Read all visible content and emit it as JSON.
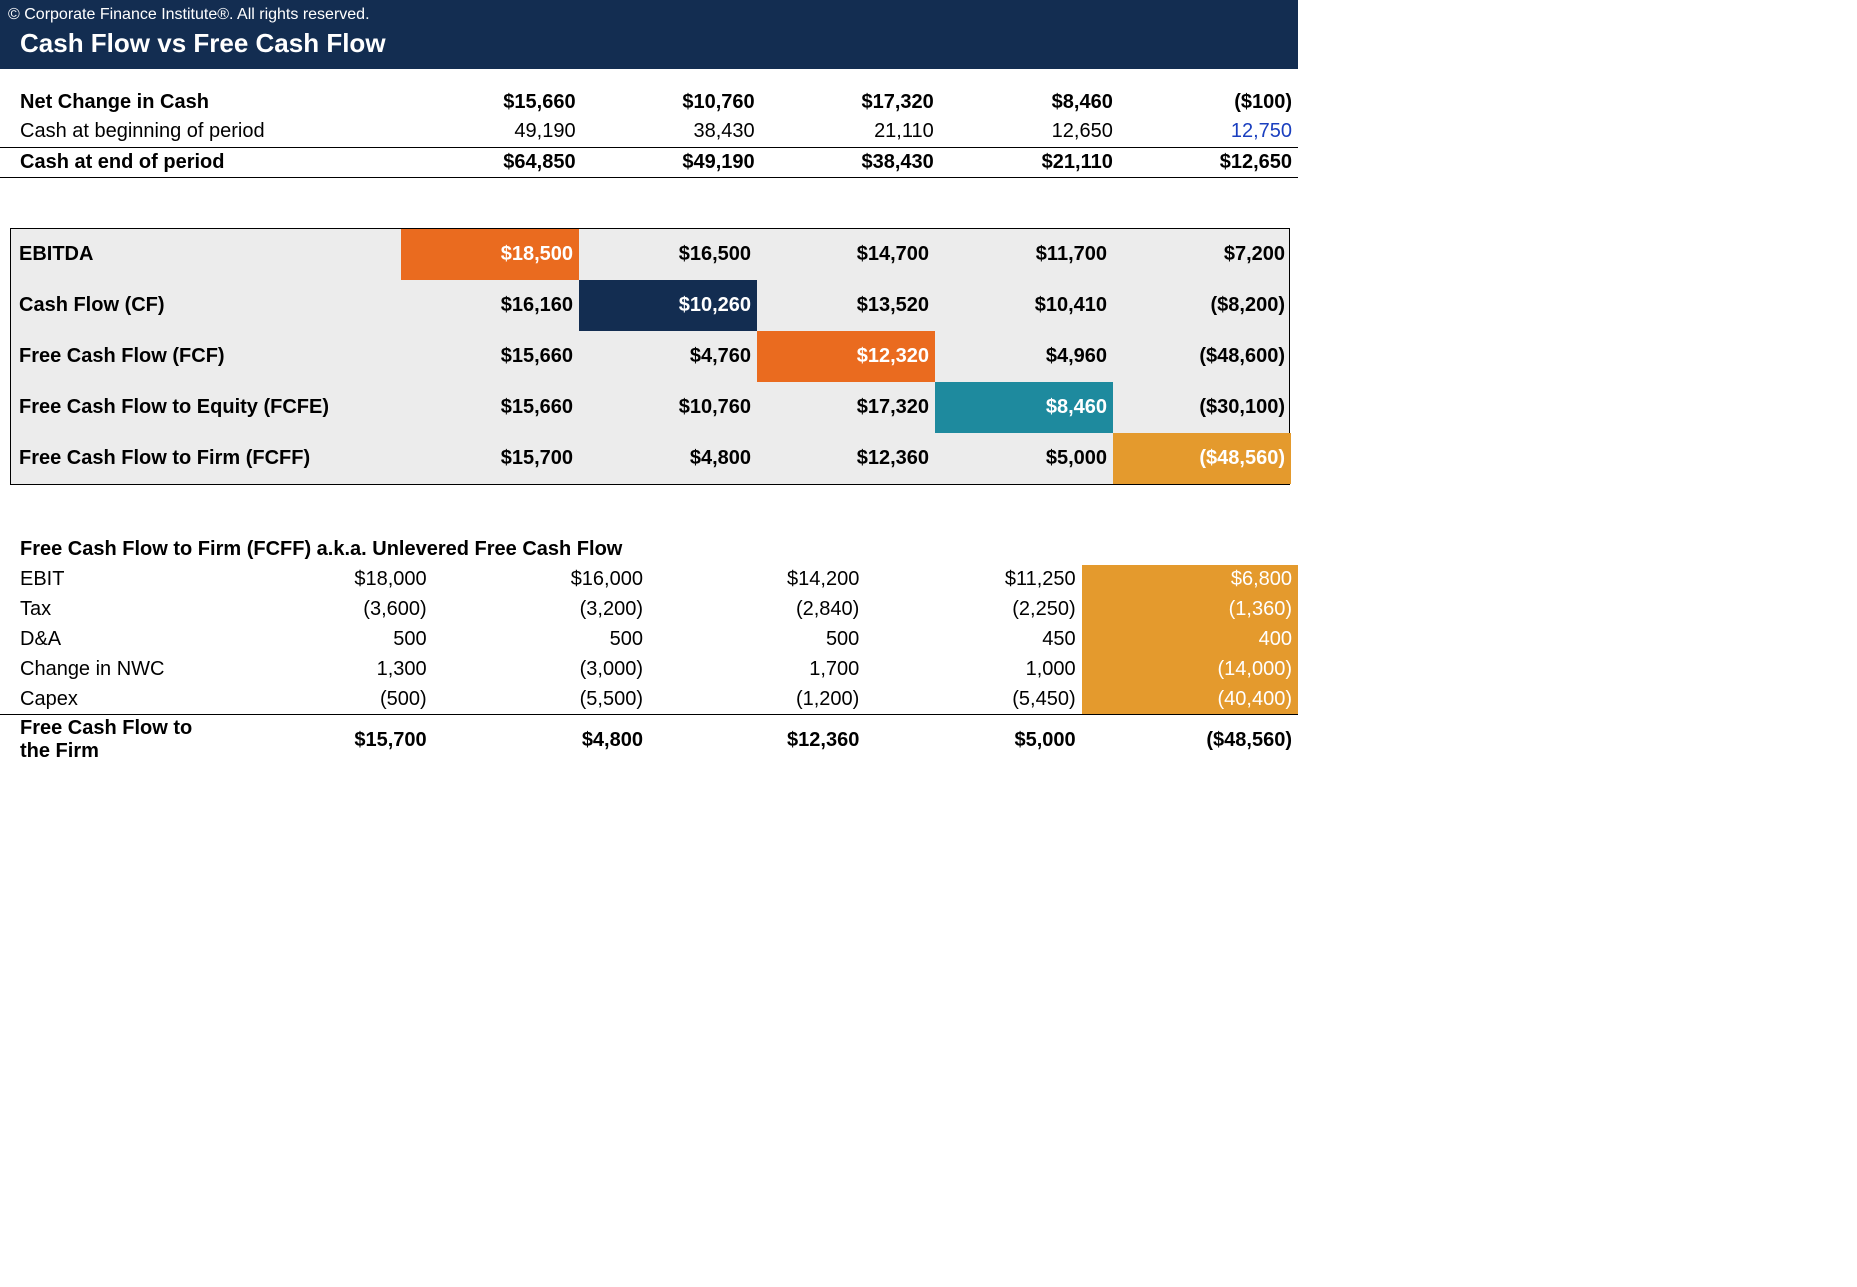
{
  "header": {
    "copyright": "© Corporate Finance Institute®. All rights reserved.",
    "title": "Cash Flow vs Free Cash Flow"
  },
  "cash_summary": {
    "net_change": {
      "label": "Net Change in Cash",
      "c1": "$15,660",
      "c2": "$10,760",
      "c3": "$17,320",
      "c4": "$8,460",
      "c5": "($100)"
    },
    "begin": {
      "label": "Cash at beginning of period",
      "c1": "49,190",
      "c2": "38,430",
      "c3": "21,110",
      "c4": "12,650",
      "c5": "12,750"
    },
    "end": {
      "label": "Cash at end of period",
      "c1": "$64,850",
      "c2": "$49,190",
      "c3": "$38,430",
      "c4": "$21,110",
      "c5": "$12,650"
    }
  },
  "metrics": {
    "ebitda": {
      "label": "EBITDA",
      "c1": "$18,500",
      "c2": "$16,500",
      "c3": "$14,700",
      "c4": "$11,700",
      "c5": "$7,200"
    },
    "cf": {
      "label": "Cash Flow (CF)",
      "c1": "$16,160",
      "c2": "$10,260",
      "c3": "$13,520",
      "c4": "$10,410",
      "c5": "($8,200)"
    },
    "fcf": {
      "label": "Free Cash Flow (FCF)",
      "c1": "$15,660",
      "c2": "$4,760",
      "c3": "$12,320",
      "c4": "$4,960",
      "c5": "($48,600)"
    },
    "fcfe": {
      "label": "Free Cash Flow to Equity (FCFE)",
      "c1": "$15,660",
      "c2": "$10,760",
      "c3": "$17,320",
      "c4": "$8,460",
      "c5": "($30,100)"
    },
    "fcff": {
      "label": "Free Cash Flow to Firm (FCFF)",
      "c1": "$15,700",
      "c2": "$4,800",
      "c3": "$12,360",
      "c4": "$5,000",
      "c5": "($48,560)"
    }
  },
  "fcff_detail": {
    "title": "Free Cash Flow to Firm (FCFF) a.k.a. Unlevered Free Cash Flow",
    "ebit": {
      "label": "EBIT",
      "c1": "$18,000",
      "c2": "$16,000",
      "c3": "$14,200",
      "c4": "$11,250",
      "c5": "$6,800"
    },
    "tax": {
      "label": "Tax",
      "c1": "(3,600)",
      "c2": "(3,200)",
      "c3": "(2,840)",
      "c4": "(2,250)",
      "c5": "(1,360)"
    },
    "da": {
      "label": "D&A",
      "c1": "500",
      "c2": "500",
      "c3": "500",
      "c4": "450",
      "c5": "400"
    },
    "nwc": {
      "label": "Change in NWC",
      "c1": "1,300",
      "c2": "(3,000)",
      "c3": "1,700",
      "c4": "1,000",
      "c5": "(14,000)"
    },
    "capex": {
      "label": "Capex",
      "c1": "(500)",
      "c2": "(5,500)",
      "c3": "(1,200)",
      "c4": "(5,450)",
      "c5": "(40,400)"
    },
    "total": {
      "label": "Free Cash Flow to the Firm",
      "c1": "$15,700",
      "c2": "$4,800",
      "c3": "$12,360",
      "c4": "$5,000",
      "c5": "($48,560)"
    }
  },
  "colors": {
    "header_bg": "#132d51",
    "highlight_orange": "#ea6b1f",
    "highlight_navy": "#132d51",
    "highlight_teal": "#1e8a9e",
    "highlight_amber": "#e49a2d",
    "link_blue": "#1a3fbf"
  }
}
